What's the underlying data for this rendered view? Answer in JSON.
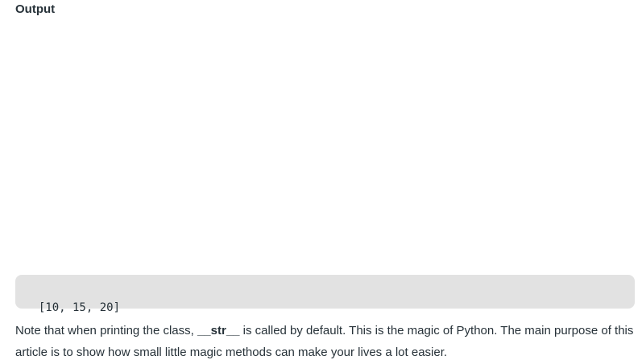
{
  "heading": "Output",
  "code": {
    "text": "[10, 15, 20]"
  },
  "paragraph": {
    "before": "Note that when printing the class, ",
    "bold": "__str__",
    "after": " is called by default. This is the magic of Python. The main purpose of this article is to show how small little magic methods can make your lives a lot easier."
  }
}
